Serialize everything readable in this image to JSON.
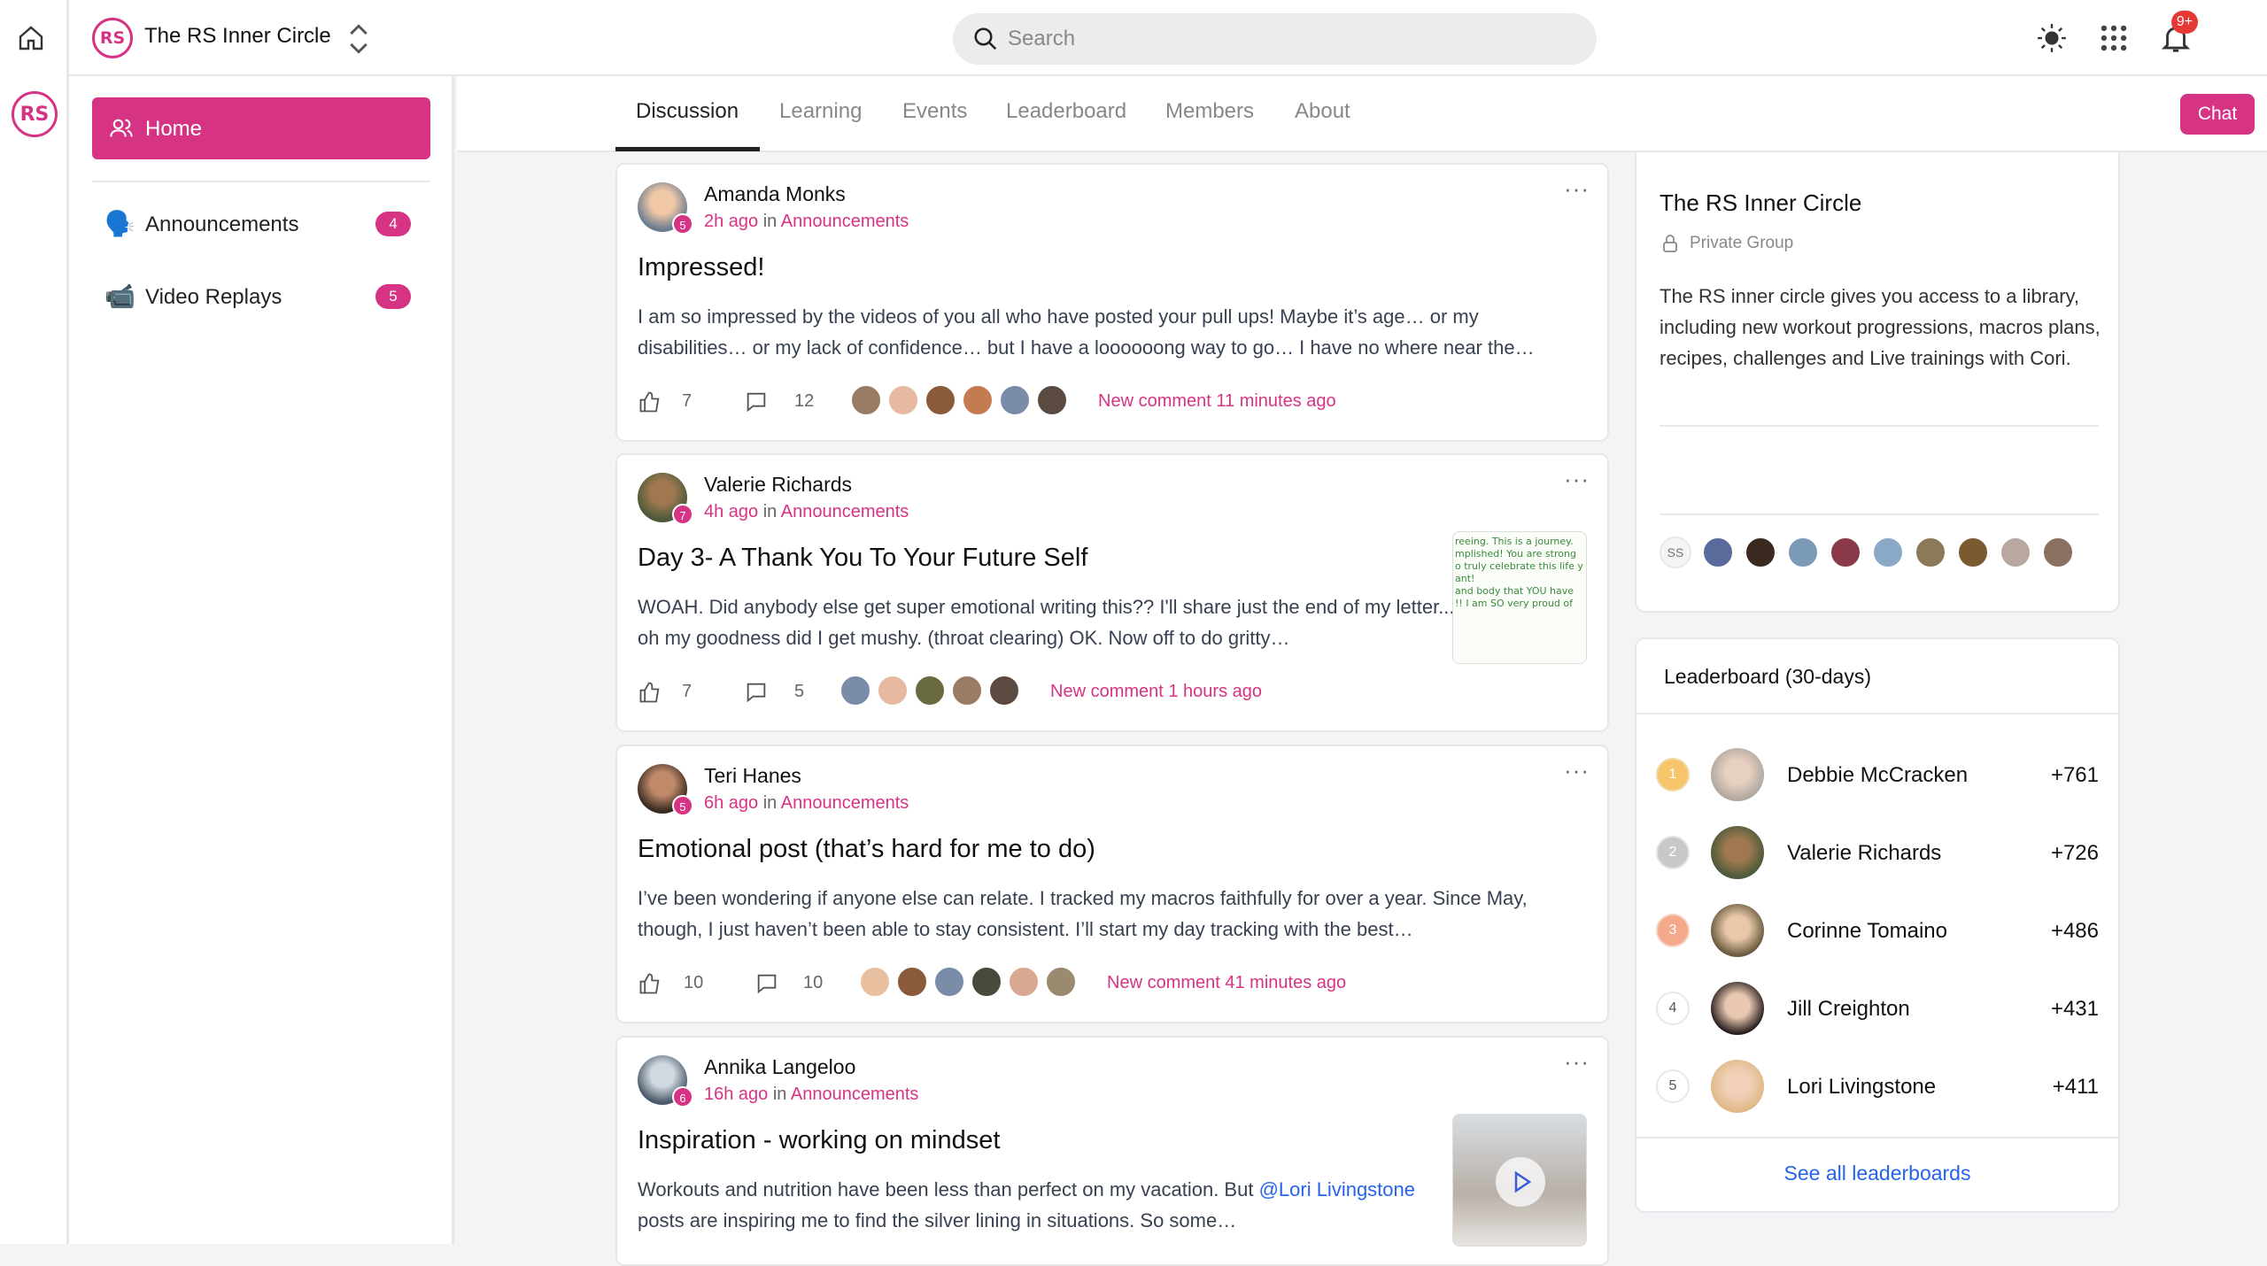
{
  "app": {
    "group_name": "The RS Inner Circle",
    "logo_text": "RS",
    "notification_badge": "9+",
    "accent_color": "#d63384"
  },
  "search": {
    "placeholder": "Search",
    "value": ""
  },
  "sidebar": {
    "home_label": "Home",
    "items": [
      {
        "label": "Announcements",
        "count": "4",
        "icon": "🗣️"
      },
      {
        "label": "Video Replays",
        "count": "5",
        "icon": "📹"
      }
    ]
  },
  "tabs": [
    "Discussion",
    "Learning",
    "Events",
    "Leaderboard",
    "Members",
    "About"
  ],
  "active_tab": "Discussion",
  "chat_label": "Chat",
  "posts": [
    {
      "author": "Amanda Monks",
      "level": "5",
      "time": "2h ago",
      "in": "in",
      "space": "Announcements",
      "title": "Impressed!",
      "body": "I am so impressed by the videos of you all who have posted your pull ups! Maybe it’s age… or my disabilities… or my lack of confidence… but I have a loooooong way to go… I have no where near the…",
      "likes": "7",
      "comments": "12",
      "new_comment": "New comment 11 minutes ago"
    },
    {
      "author": "Valerie Richards",
      "level": "7",
      "time": "4h ago",
      "in": "in",
      "space": "Announcements",
      "title": "Day 3- A Thank You To Your Future Self",
      "body": "WOAH. Did anybody else get super emotional writing this?? I'll share just the end of my letter... oh my goodness did I get mushy. (throat clearing) OK. Now off to do gritty…",
      "likes": "7",
      "comments": "5",
      "new_comment": "New comment 1 hours ago",
      "thumb_text": [
        "reeing. This is a journey.",
        "mplished! You are strong",
        "o truly celebrate this life y",
        "ant!",
        "and body that YOU have",
        "!! I am SO very proud of"
      ]
    },
    {
      "author": "Teri Hanes",
      "level": "5",
      "time": "6h ago",
      "in": "in",
      "space": "Announcements",
      "title": "Emotional post (that’s hard for me to do)",
      "body": "I’ve been wondering if anyone else can relate. I tracked my macros faithfully for over a year. Since May, though, I just haven’t been able to stay consistent. I’ll start my day tracking with the best…",
      "likes": "10",
      "comments": "10",
      "new_comment": "New comment 41 minutes ago"
    },
    {
      "author": "Annika Langeloo",
      "level": "6",
      "time": "16h ago",
      "in": "in",
      "space": "Announcements",
      "title": "Inspiration - working on mindset",
      "body_before": "Workouts and nutrition have been less than perfect on my vacation. But ",
      "mention": "@Lori Livingstone",
      "body_after": " posts are inspiring me to find the silver lining in situations. So some…"
    }
  ],
  "about_card": {
    "title": "The RS Inner Circle",
    "privacy": "Private Group",
    "description": "The RS inner circle gives you access to a library, including new workout progressions, macros plans, recipes, challenges and Live trainings with Cori.",
    "member_initials": "SS"
  },
  "leaderboard": {
    "title": "Leaderboard (30-days)",
    "rows": [
      {
        "rank": "1",
        "name": "Debbie McCracken",
        "points": "+761"
      },
      {
        "rank": "2",
        "name": "Valerie Richards",
        "points": "+726"
      },
      {
        "rank": "3",
        "name": "Corinne Tomaino",
        "points": "+486"
      },
      {
        "rank": "4",
        "name": "Jill Creighton",
        "points": "+431"
      },
      {
        "rank": "5",
        "name": "Lori Livingstone",
        "points": "+411"
      }
    ],
    "see_all": "See all leaderboards"
  }
}
